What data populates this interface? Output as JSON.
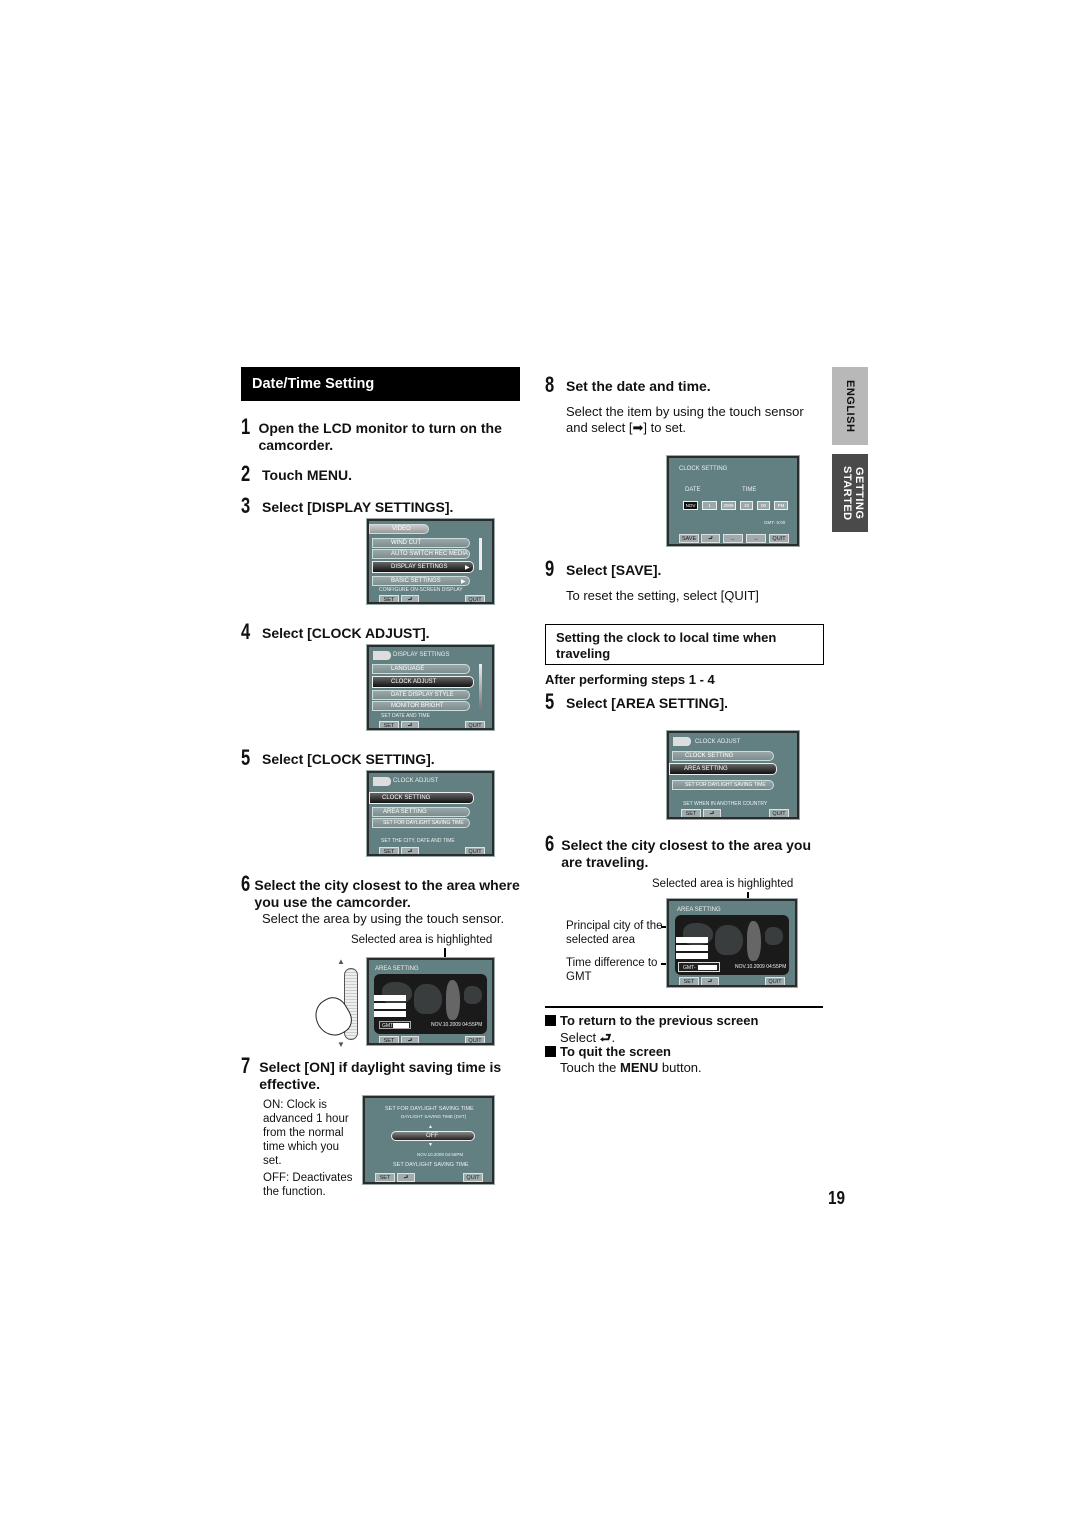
{
  "section_title": "Date/Time Setting",
  "left_steps": [
    {
      "num": "1",
      "text": "Open the LCD monitor to turn on the camcorder."
    },
    {
      "num": "2",
      "text": "Touch MENU."
    },
    {
      "num": "3",
      "text": "Select [DISPLAY SETTINGS]."
    },
    {
      "num": "4",
      "text": "Select [CLOCK ADJUST]."
    },
    {
      "num": "5",
      "text": "Select [CLOCK SETTING]."
    },
    {
      "num": "6",
      "text": "Select the city closest to the area where you use the camcorder.",
      "sub": "Select the area by using the touch sensor."
    },
    {
      "num": "7",
      "text": "Select [ON] if daylight saving time is effective."
    }
  ],
  "selected_area_note": "Selected area is highlighted",
  "dst_on_note": "ON: Clock is advanced 1 hour from the normal time which you set.",
  "dst_off_note": "OFF: Deactivates the function.",
  "screens": {
    "menu": {
      "header": "VIDEO",
      "items": [
        "WIND CUT",
        "AUTO SWITCH REC MEDIA",
        "DISPLAY SETTINGS",
        "BASIC SETTINGS"
      ],
      "selected": "DISPLAY SETTINGS",
      "hint": "CONFIGURE ON-SCREEN DISPLAY",
      "set": "SET",
      "quit": "QUIT"
    },
    "display_settings": {
      "header": "DISPLAY SETTINGS",
      "items": [
        "LANGUAGE",
        "CLOCK ADJUST",
        "DATE DISPLAY STYLE",
        "MONITOR BRIGHT"
      ],
      "selected": "CLOCK ADJUST",
      "hint": "SET DATE AND TIME",
      "set": "SET",
      "quit": "QUIT"
    },
    "clock_adjust_1": {
      "header": "CLOCK ADJUST",
      "items": [
        "CLOCK SETTING",
        "AREA SETTING",
        "SET FOR DAYLIGHT SAVING TIME"
      ],
      "selected": "CLOCK SETTING",
      "hint": "SET THE CITY, DATE AND TIME",
      "set": "SET",
      "quit": "QUIT"
    },
    "area_setting": {
      "header": "AREA SETTING",
      "gmt_label": "GMT-",
      "datetime": "NOV.10.2009 04:55PM",
      "set": "SET",
      "quit": "QUIT"
    },
    "dst": {
      "title": "SET FOR DAYLIGHT SAVING TIME",
      "subtitle": "DAYLIGHT SAVING TIME (DST)",
      "value": "OFF",
      "datetime": "NOV.10.2009 04:55PM",
      "hint": "SET DAYLIGHT SAVING TIME",
      "set": "SET",
      "quit": "QUIT"
    },
    "clock_setting": {
      "header": "CLOCK SETTING",
      "date_label": "DATE",
      "time_label": "TIME",
      "fields": [
        "NOV",
        "1",
        "2009",
        "10",
        "00",
        "PM"
      ],
      "gmt": "GMT- 5:00",
      "save": "SAVE",
      "quit": "QUIT"
    },
    "clock_adjust_2": {
      "header": "CLOCK ADJUST",
      "items": [
        "CLOCK SETTING",
        "AREA SETTING",
        "SET FOR DAYLIGHT SAVING TIME"
      ],
      "selected": "AREA SETTING",
      "hint": "SET WHEN IN ANOTHER COUNTRY",
      "set": "SET",
      "quit": "QUIT"
    },
    "area_setting_2": {
      "header": "AREA SETTING",
      "gmt_label": "GMT-",
      "datetime": "NOV.10.2009 04:55PM",
      "set": "SET",
      "quit": "QUIT"
    }
  },
  "right": {
    "step8": {
      "num": "8",
      "text": "Set the date and time.",
      "body_a": "Select the item by using the touch sensor",
      "body_b_pre": "and select [",
      "body_b_post": "] to set."
    },
    "step9": {
      "num": "9",
      "text": "Select [SAVE].",
      "body": "To reset the setting, select [QUIT]"
    },
    "travel_box": "Setting the clock to local time when traveling",
    "after_steps": "After performing steps ",
    "after_range": "1 - 4",
    "step5": {
      "num": "5",
      "text": "Select [AREA SETTING]."
    },
    "step6": {
      "num": "6",
      "text": "Select the city closest to the area you are traveling."
    },
    "selected_area_note": "Selected area is highlighted",
    "principal_city": "Principal city of the selected area",
    "time_diff": "Time difference to GMT",
    "return_title": "To return to the previous screen",
    "return_body_pre": "Select ",
    "return_body_post": ".",
    "quit_title": "To quit the screen",
    "quit_body_pre": "Touch the ",
    "quit_body_bold": "MENU",
    "quit_body_post": " button."
  },
  "side_tabs": {
    "english": "ENGLISH",
    "getting_started": "GETTING STARTED"
  },
  "page_number": "19"
}
